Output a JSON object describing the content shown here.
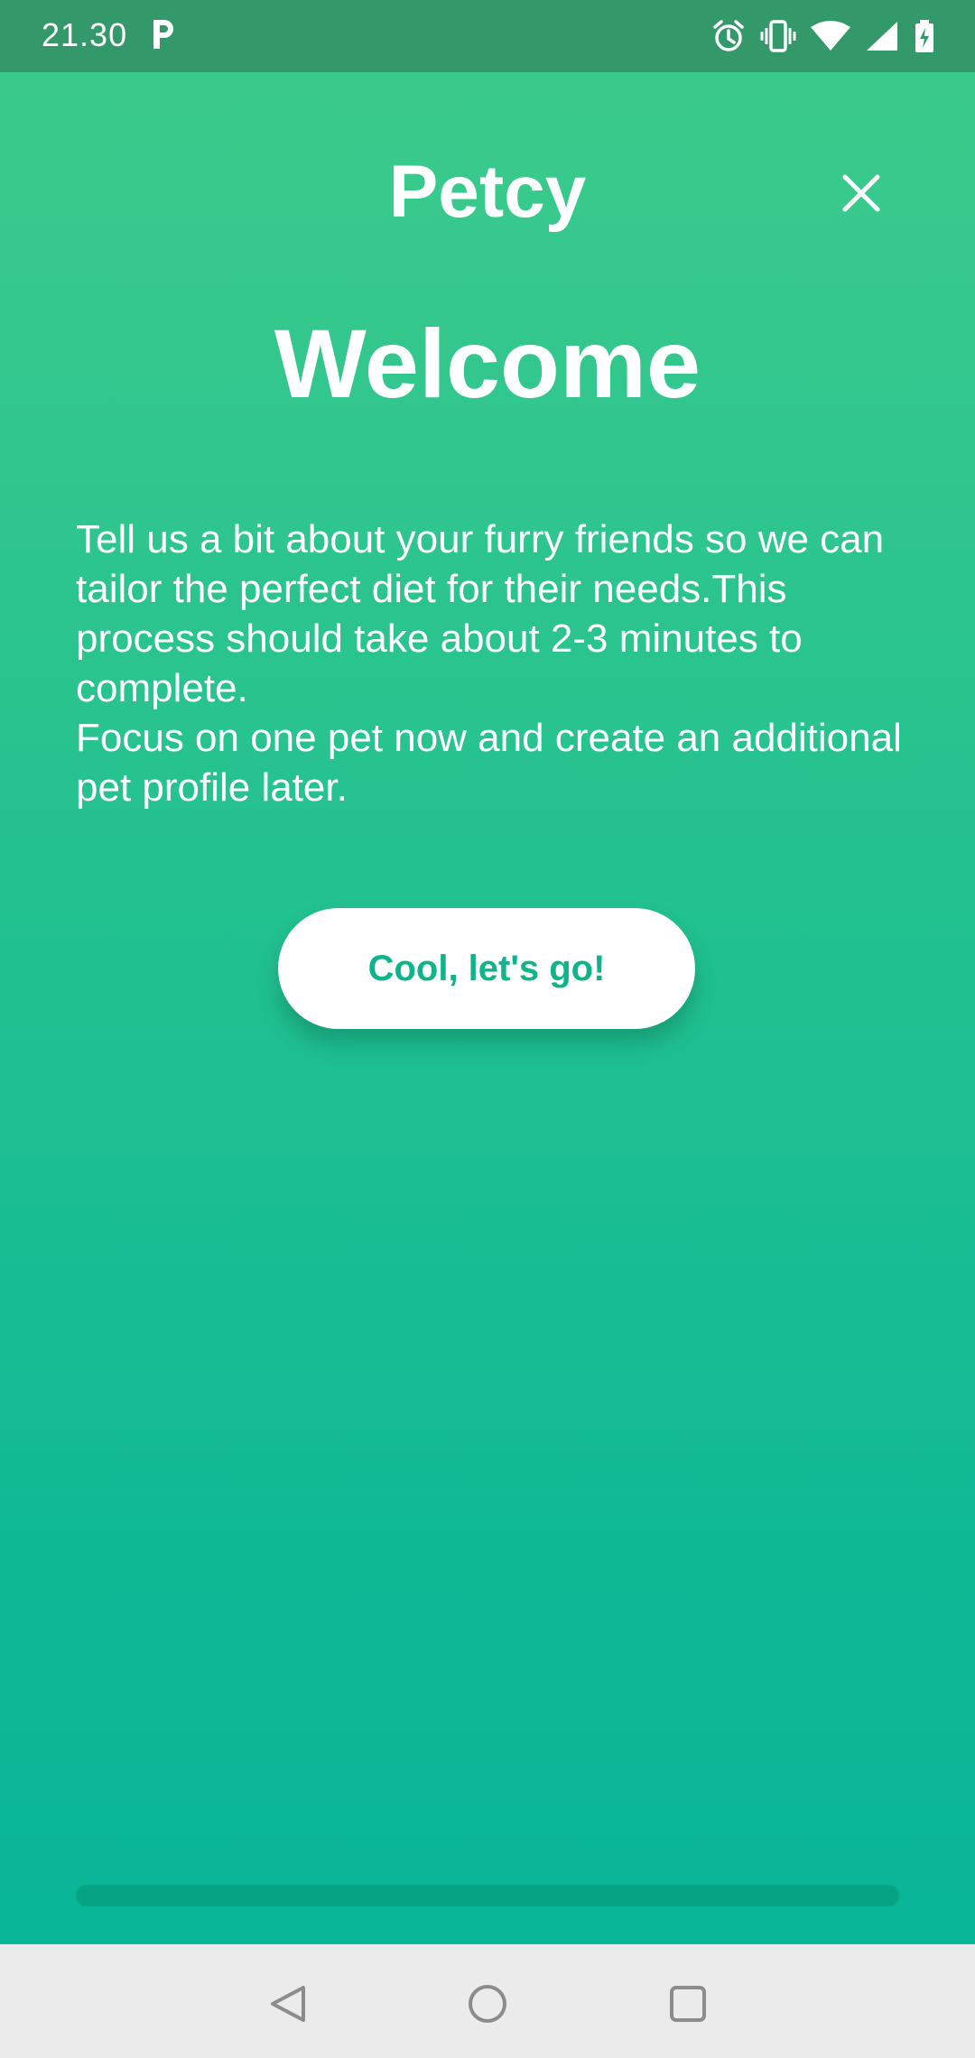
{
  "status_bar": {
    "time": "21.30",
    "icons": [
      "parking-app-icon",
      "alarm-icon",
      "vibrate-icon",
      "wifi-icon",
      "signal-icon",
      "battery-charging-icon"
    ]
  },
  "header": {
    "app_title": "Petcy",
    "close_icon": "close-icon"
  },
  "main": {
    "heading": "Welcome",
    "description_lines": [
      "Tell us a bit about your furry friends so we can tailor the perfect diet for their needs.This process should take about 2-3 minutes to complete.",
      "Focus on one pet now and create an additional pet profile later."
    ],
    "cta_label": "Cool, let's go!"
  },
  "progress": {
    "value": 0
  },
  "nav_bar": {
    "buttons": [
      "back-icon",
      "home-icon",
      "recents-icon"
    ]
  },
  "colors": {
    "gradient_top": "#3ecb8c",
    "gradient_bottom": "#07b598",
    "status_bar": "#34996a",
    "accent_text": "#10b48a",
    "progress_track": "#06a384",
    "nav_bar": "#ebebeb"
  }
}
